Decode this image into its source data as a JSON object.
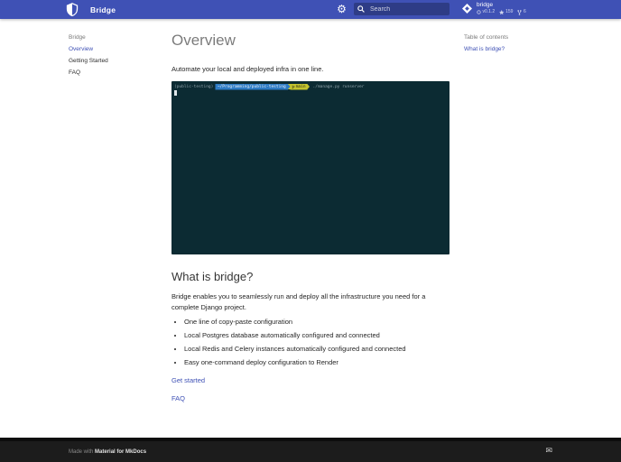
{
  "header": {
    "title": "Bridge",
    "search": {
      "placeholder": "Search"
    },
    "repo": {
      "name": "bridge",
      "version": "v0.1.2",
      "stars": "159",
      "forks": "6"
    }
  },
  "sidebar": {
    "title": "Bridge",
    "items": [
      {
        "label": "Overview",
        "active": true
      },
      {
        "label": "Getting Started",
        "active": false
      },
      {
        "label": "FAQ",
        "active": false
      }
    ]
  },
  "toc": {
    "title": "Table of contents",
    "items": [
      {
        "label": "What is bridge?"
      }
    ]
  },
  "main": {
    "h1": "Overview",
    "intro": "Automate your local and deployed infra in one line.",
    "terminal": {
      "venv": "(public-testing)",
      "path": "~/Programming/public-testing",
      "branch": "main",
      "command": "./manage.py runserver"
    },
    "h2": "What is bridge?",
    "paragraph": "Bridge enables you to seamlessly run and deploy all the infrastructure you need for a complete Django project.",
    "bullets": [
      "One line of copy-paste configuration",
      "Local Postgres database automatically configured and connected",
      "Local Redis and Celery instances automatically configured and connected",
      "Easy one-command deploy configuration to Render"
    ],
    "links": {
      "get_started": "Get started",
      "faq": "FAQ"
    }
  },
  "footer": {
    "made_with": "Made with",
    "brand": "Material for MkDocs"
  },
  "colors": {
    "accent": "#3f51b5",
    "terminal_bg": "#0c2b33",
    "prompt_path_bg": "#2d7bc4",
    "prompt_branch_bg": "#c4c42e",
    "footer_bg": "#1c1c1c"
  }
}
